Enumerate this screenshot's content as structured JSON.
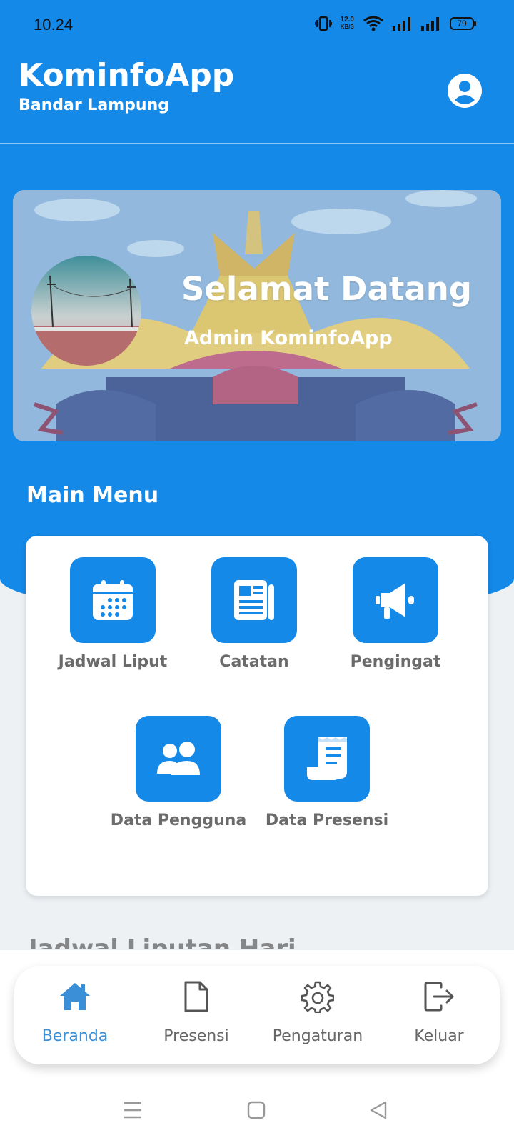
{
  "status_bar": {
    "time": "10.24",
    "net_speed_value": "12.0",
    "net_speed_unit": "KB/S",
    "battery": "79"
  },
  "header": {
    "title": "KominfoApp",
    "subtitle": "Bandar Lampung",
    "profile_icon": "account-circle-icon"
  },
  "banner": {
    "title": "Selamat Datang",
    "subtitle": "Admin KominfoApp"
  },
  "main_menu": {
    "title": "Main Menu",
    "items": [
      {
        "label": "Jadwal Liput",
        "icon": "calendar-icon"
      },
      {
        "label": "Catatan",
        "icon": "newspaper-icon"
      },
      {
        "label": "Pengingat",
        "icon": "megaphone-icon"
      },
      {
        "label": "Data Pengguna",
        "icon": "users-icon"
      },
      {
        "label": "Data Presensi",
        "icon": "receipt-icon"
      }
    ]
  },
  "faded_section_title": "Jadwal Liputan Hari Ini",
  "bottom_nav": {
    "items": [
      {
        "label": "Beranda",
        "icon": "home-icon",
        "active": true
      },
      {
        "label": "Presensi",
        "icon": "document-icon",
        "active": false
      },
      {
        "label": "Pengaturan",
        "icon": "gear-icon",
        "active": false
      },
      {
        "label": "Keluar",
        "icon": "logout-icon",
        "active": false
      }
    ]
  },
  "colors": {
    "primary": "#1589e8",
    "active_nav": "#3a8fd6",
    "menu_label": "#6b6b6b",
    "background": "#edf1f4"
  }
}
